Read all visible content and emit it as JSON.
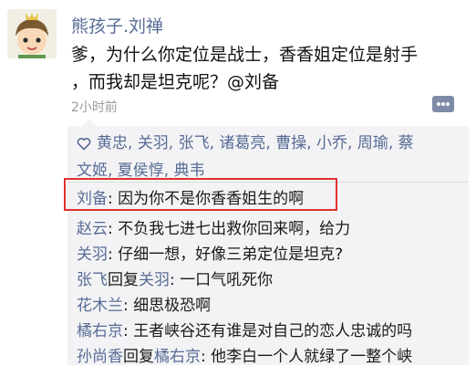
{
  "post": {
    "author": "熊孩子.刘禅",
    "lines": [
      "爹，为什么你定位是战士，香香姐定位是射手",
      "，而我却是坦克呢？@刘备"
    ],
    "time": "2小时前",
    "avatar_icon": "cartoon-boy-avatar",
    "more_icon": "more-dots-icon"
  },
  "likes": {
    "icon": "heart-outline-icon",
    "line1": "黄忠, 关羽, 张飞, 诸葛亮, 曹操, 小乔, 周瑜, 蔡",
    "line2": "文姬, 夏侯惇, 典韦"
  },
  "comments": [
    {
      "author": "刘备",
      "sep": ": ",
      "text": "因为你不是你香香姐生的啊"
    },
    {
      "author": "赵云",
      "sep": ": ",
      "text": "不负我七进七出救你回来啊，给力"
    },
    {
      "author": "关羽",
      "sep": ": ",
      "text": "仔细一想，好像三弟定位是坦克?"
    },
    {
      "author": "张飞",
      "reply_word": "回复",
      "reply_to": "关羽",
      "sep": ": ",
      "text": "一口气吼死你"
    },
    {
      "author": "花木兰",
      "sep": ": ",
      "text": "细思极恐啊"
    },
    {
      "author": "橘右京",
      "sep": ": ",
      "text": "王者峡谷还有谁是对自己的恋人忠诚的吗"
    },
    {
      "author": "孙尚香",
      "reply_word": "回复",
      "reply_to": "橘右京",
      "sep": ": ",
      "text": "他李白一个人就绿了一整个峡"
    }
  ],
  "colors": {
    "link": "#576b95",
    "highlight_box": "#e0302e",
    "panel_bg": "#f3f3f5"
  }
}
